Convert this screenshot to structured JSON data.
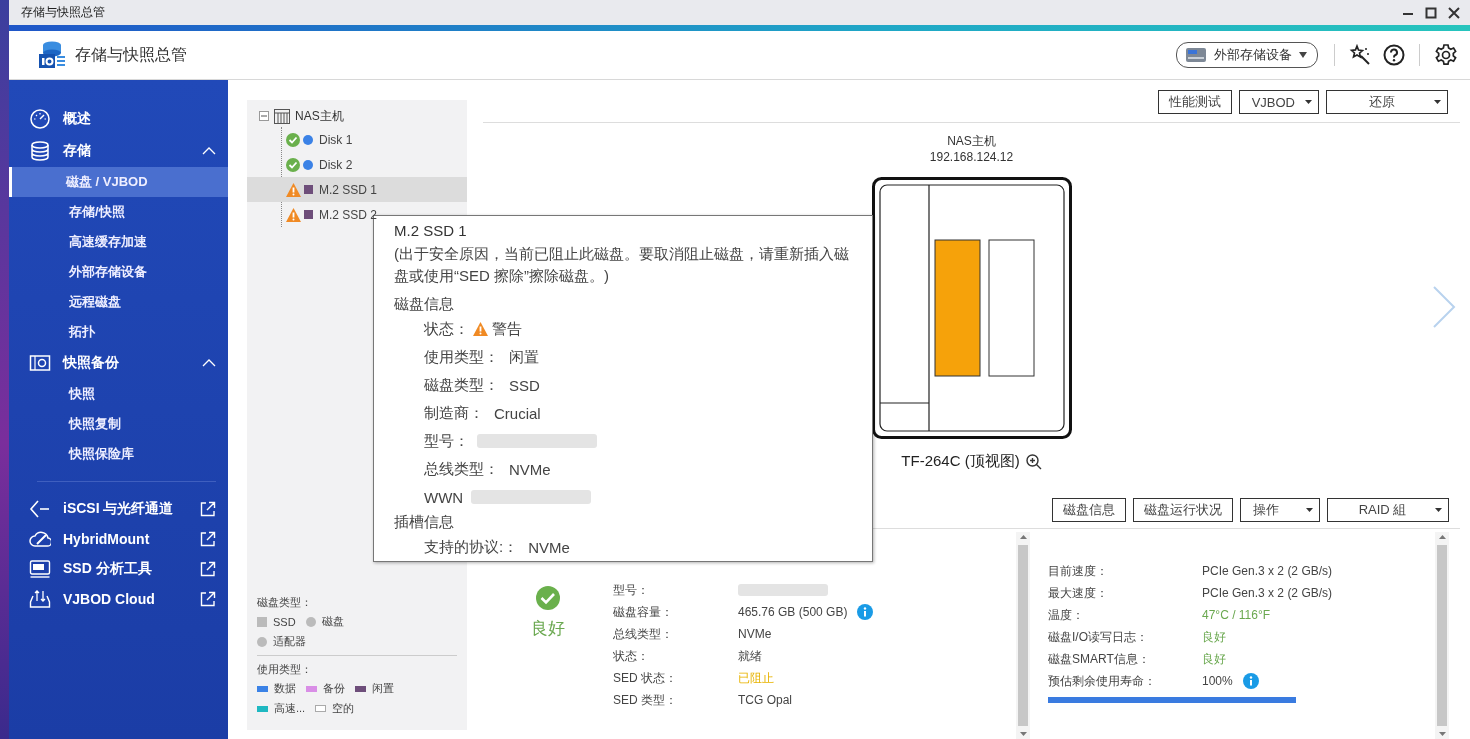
{
  "window": {
    "title": "存储与快照总管"
  },
  "app": {
    "title": "存储与快照总管",
    "device_menu": "外部存储设备"
  },
  "sidebar": {
    "sections": [
      {
        "label": "概述"
      },
      {
        "label": "存储",
        "expanded": true,
        "children": [
          {
            "label": "磁盘 / VJBOD",
            "selected": true
          },
          {
            "label": "存储/快照",
            "selected": false
          },
          {
            "label": "高速缓存加速",
            "selected": false
          },
          {
            "label": "外部存储设备",
            "selected": false
          },
          {
            "label": "远程磁盘",
            "selected": false
          },
          {
            "label": "拓扑",
            "selected": false
          }
        ]
      },
      {
        "label": "快照备份",
        "expanded": true,
        "children": [
          {
            "label": "快照",
            "selected": false
          },
          {
            "label": "快照复制",
            "selected": false
          },
          {
            "label": "快照保险库",
            "selected": false
          }
        ]
      }
    ],
    "links": [
      {
        "label": "iSCSI 与光纤通道"
      },
      {
        "label": "HybridMount"
      },
      {
        "label": "SSD 分析工具"
      },
      {
        "label": "VJBOD Cloud"
      }
    ]
  },
  "tree": {
    "label": "NAS主机",
    "expanded": true,
    "children": [
      {
        "label": "Disk 1",
        "warning": false,
        "kind": "disk",
        "color": "#3b82e6",
        "selected": false
      },
      {
        "label": "Disk 2",
        "warning": false,
        "kind": "disk",
        "color": "#3b82e6",
        "selected": false
      },
      {
        "label": "M.2 SSD 1",
        "warning": true,
        "kind": "ssd",
        "color": "#6e4e7a",
        "selected": true
      },
      {
        "label": "M.2 SSD 2",
        "warning": true,
        "kind": "ssd",
        "color": "#6e4e7a",
        "selected": false
      }
    ]
  },
  "legend": {
    "disk_type_title": "磁盘类型：",
    "disk_types": [
      {
        "label": "SSD",
        "kind": "square"
      },
      {
        "label": "磁盘",
        "kind": "circle"
      },
      {
        "label": "适配器",
        "kind": "circle"
      }
    ],
    "usage_title": "使用类型：",
    "usage_types": [
      {
        "label": "数据",
        "kind": "swatch",
        "color": "#3b82e6"
      },
      {
        "label": "备份",
        "kind": "swatch",
        "color": "#d98ee6"
      },
      {
        "label": "闲置",
        "kind": "swatch",
        "color": "#6e4e7a"
      },
      {
        "label": "高速...",
        "kind": "swatch",
        "color": "#1fb8c1"
      },
      {
        "label": "空的",
        "kind": "empty"
      }
    ]
  },
  "toolbar": [
    {
      "label": "性能测试",
      "kind": "button"
    },
    {
      "label": "VJBOD",
      "kind": "dropdown"
    },
    {
      "label": "还原",
      "kind": "dropdown"
    }
  ],
  "enclosure": {
    "name": "NAS主机",
    "ip": "192.168.124.12",
    "caption": "TF-264C (顶视图)",
    "slots": [
      {
        "selected": true
      },
      {
        "selected": false
      }
    ]
  },
  "disk_toolbar": [
    {
      "label": "磁盘信息",
      "kind": "button"
    },
    {
      "label": "磁盘运行状况",
      "kind": "button"
    },
    {
      "label": "操作",
      "kind": "dropdown"
    },
    {
      "label": "RAID 組",
      "kind": "dropdown"
    }
  ],
  "summary": {
    "status": "良好"
  },
  "details": [
    {
      "label": "型号：",
      "kind": "blurred"
    },
    {
      "label": "磁盘容量：",
      "value": "465.76 GB (500 GB)",
      "kind": "info"
    },
    {
      "label": "总线类型：",
      "value": "NVMe",
      "kind": "plain"
    },
    {
      "label": "状态：",
      "value": "就绪",
      "kind": "plain"
    },
    {
      "label": "SED 状态：",
      "value": "已阻止",
      "kind": "warning"
    },
    {
      "label": "SED 类型：",
      "value": "TCG Opal",
      "kind": "plain"
    }
  ],
  "health": [
    {
      "label": "目前速度：",
      "value": "PCIe Gen.3 x 2 (2 GB/s)",
      "kind": "plain"
    },
    {
      "label": "最大速度：",
      "value": "PCIe Gen.3 x 2 (2 GB/s)",
      "kind": "plain"
    },
    {
      "label": "温度：",
      "value": "47°C / 116°F",
      "kind": "good"
    },
    {
      "label": "磁盘I/O读写日志：",
      "value": "良好",
      "kind": "good"
    },
    {
      "label": "磁盘SMART信息：",
      "value": "良好",
      "kind": "good"
    },
    {
      "label": "预估剩余使用寿命：",
      "value": "100%",
      "kind": "info"
    }
  ],
  "life": {
    "level": 1
  },
  "tooltip": {
    "title": "M.2 SSD 1",
    "note": "(出于安全原因，当前已阻止此磁盘。要取消阻止磁盘，请重新插入磁盘或使用“SED 擦除”擦除磁盘。)",
    "sections": [
      {
        "title": "磁盘信息",
        "rows": [
          {
            "label": "状态：",
            "value": "警告",
            "kind": "warning"
          },
          {
            "label": "使用类型：",
            "value": "闲置",
            "kind": "plain"
          },
          {
            "label": "磁盘类型：",
            "value": "SSD",
            "kind": "plain"
          },
          {
            "label": "制造商：",
            "value": "Crucial",
            "kind": "plain"
          },
          {
            "label": "型号：",
            "kind": "blurred"
          },
          {
            "label": "总线类型：",
            "value": "NVMe",
            "kind": "plain"
          },
          {
            "label": "WWN",
            "kind": "blurred"
          }
        ]
      },
      {
        "title": "插槽信息",
        "rows": [
          {
            "label": "支持的协议:：",
            "value": "NVMe",
            "kind": "plain"
          }
        ]
      }
    ]
  }
}
